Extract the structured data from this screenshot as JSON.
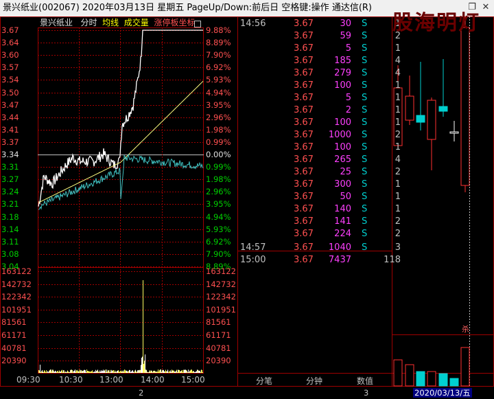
{
  "window": {
    "title": "景兴纸业(002067)  2020年03月13日 星期五  PageUp/Down:前后日  空格键:操作  通达信(R)",
    "restore_icon": "restore-icon",
    "close_icon": "close-icon"
  },
  "chart_header": {
    "stock_name": "景兴纸业",
    "mode": "分时",
    "avg_line": "均线",
    "volume": "成交量",
    "limit_coord": "涨停板坐标"
  },
  "price_axis_left": [
    "3.67",
    "3.64",
    "3.60",
    "3.57",
    "3.54",
    "3.50",
    "3.47",
    "3.44",
    "3.41",
    "3.37",
    "3.34",
    "3.31",
    "3.27",
    "3.24",
    "3.21",
    "3.18",
    "3.14",
    "3.11",
    "3.08",
    "3.04"
  ],
  "pct_axis_right": [
    "9.88%",
    "8.89%",
    "7.90%",
    "6.92%",
    "5.93%",
    "4.94%",
    "3.95%",
    "2.96%",
    "1.98%",
    "0.99%",
    "0.00%",
    "0.99%",
    "1.98%",
    "2.96%",
    "3.95%",
    "4.94%",
    "5.93%",
    "6.92%",
    "7.90%",
    "8.89%"
  ],
  "volume_axis": [
    "163122",
    "142732",
    "122342",
    "101951",
    "81561",
    "61171",
    "40781",
    "20390"
  ],
  "time_axis": [
    "09:30",
    "10:30",
    "13:00",
    "14:00",
    "15:00"
  ],
  "ticks": [
    {
      "time": "14:56",
      "price": "3.67",
      "vol": "30",
      "bs": "S",
      "cnt": "1"
    },
    {
      "time": "",
      "price": "3.67",
      "vol": "59",
      "bs": "S",
      "cnt": "2"
    },
    {
      "time": "",
      "price": "3.67",
      "vol": "5",
      "bs": "S",
      "cnt": "1"
    },
    {
      "time": "",
      "price": "3.67",
      "vol": "185",
      "bs": "S",
      "cnt": "4"
    },
    {
      "time": "",
      "price": "3.67",
      "vol": "279",
      "bs": "S",
      "cnt": "4"
    },
    {
      "time": "",
      "price": "3.67",
      "vol": "100",
      "bs": "S",
      "cnt": "1"
    },
    {
      "time": "",
      "price": "3.67",
      "vol": "5",
      "bs": "S",
      "cnt": "1"
    },
    {
      "time": "",
      "price": "3.67",
      "vol": "2",
      "bs": "S",
      "cnt": "1"
    },
    {
      "time": "",
      "price": "3.67",
      "vol": "100",
      "bs": "S",
      "cnt": "1"
    },
    {
      "time": "",
      "price": "3.67",
      "vol": "1000",
      "bs": "S",
      "cnt": "2"
    },
    {
      "time": "",
      "price": "3.67",
      "vol": "100",
      "bs": "S",
      "cnt": "1"
    },
    {
      "time": "",
      "price": "3.67",
      "vol": "265",
      "bs": "S",
      "cnt": "4"
    },
    {
      "time": "",
      "price": "3.67",
      "vol": "25",
      "bs": "S",
      "cnt": "2"
    },
    {
      "time": "",
      "price": "3.67",
      "vol": "300",
      "bs": "S",
      "cnt": "1"
    },
    {
      "time": "",
      "price": "3.67",
      "vol": "50",
      "bs": "S",
      "cnt": "1"
    },
    {
      "time": "",
      "price": "3.67",
      "vol": "140",
      "bs": "S",
      "cnt": "1"
    },
    {
      "time": "",
      "price": "3.67",
      "vol": "141",
      "bs": "S",
      "cnt": "2"
    },
    {
      "time": "",
      "price": "3.67",
      "vol": "224",
      "bs": "S",
      "cnt": "2"
    },
    {
      "time": "14:57",
      "price": "3.67",
      "vol": "1040",
      "bs": "S",
      "cnt": "3"
    },
    {
      "time": "15:00",
      "price": "3.67",
      "vol": "7437",
      "bs": "",
      "cnt": "118"
    }
  ],
  "tabs": [
    "分笔",
    "分钟",
    "数值"
  ],
  "bottom_markers": [
    "2",
    "3"
  ],
  "watermark": "股海明灯",
  "kline_marker": "杀",
  "kline_date": "2020/03/13/五",
  "colors": {
    "up": "#ff3030",
    "down": "#00d0d0",
    "avg": "#ffff80",
    "grid": "#a00000",
    "background": "#000000"
  }
}
